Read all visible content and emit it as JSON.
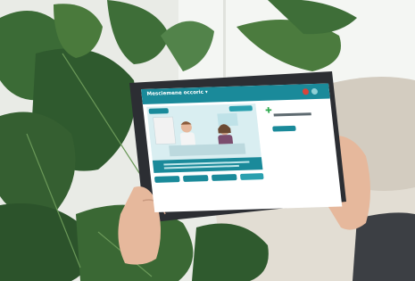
{
  "screen": {
    "header_title": "Mesciemene occoric ▾"
  },
  "colors": {
    "wall": "#e9ebe6",
    "window": "#f4f6f3",
    "leaf_dark": "#2f5a2e",
    "leaf_mid": "#4a7a3c",
    "sofa": "#e2ddd3",
    "pillow": "#d3ccc0",
    "tablet_frame": "#2c2e33",
    "app_header": "#1a8a9a",
    "app_panel": "#d9eef1",
    "badge_red": "#d9443a",
    "skin": "#e6b89c",
    "sleeve": "#3c3f44"
  },
  "icons": [
    "monstera-plant",
    "tablet",
    "hands",
    "pharmacy-cross-logo",
    "close-dot",
    "info-dot"
  ]
}
